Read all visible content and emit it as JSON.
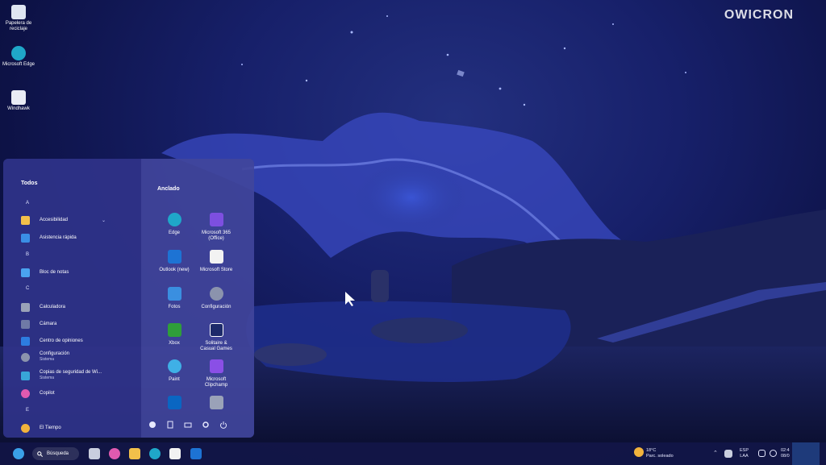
{
  "watermark": "OWICRON",
  "desktop": {
    "icons": [
      {
        "name": "recycle-bin-icon",
        "label_line1": "Papelera de",
        "label_line2": "reciclaje"
      },
      {
        "name": "edge-desktop-icon",
        "label_line1": "Microsoft Edge",
        "label_line2": ""
      },
      {
        "name": "windhawk-icon",
        "label_line1": "Windhawk",
        "label_line2": ""
      }
    ]
  },
  "start_menu": {
    "all_header": "Todos",
    "pinned_header": "Anclado",
    "letters": [
      "A",
      "B",
      "C",
      "E"
    ],
    "apps": [
      {
        "label": "Accesibilidad",
        "sub": "",
        "icon": "folder-icon",
        "color": "#f2c04a"
      },
      {
        "label": "Asistencia rápida",
        "sub": "",
        "icon": "quick-assist-icon",
        "color": "#3a8ee6"
      },
      {
        "label": "Bloc de notas",
        "sub": "",
        "icon": "notepad-icon",
        "color": "#4aa3f0"
      },
      {
        "label": "Calculadora",
        "sub": "",
        "icon": "calculator-icon",
        "color": "#9aa2b8"
      },
      {
        "label": "Cámara",
        "sub": "",
        "icon": "camera-icon",
        "color": "#6f7aa6"
      },
      {
        "label": "Centro de opiniones",
        "sub": "",
        "icon": "feedback-icon",
        "color": "#2d7de0"
      },
      {
        "label": "Configuración",
        "sub": "Sistema",
        "icon": "settings-icon",
        "color": "#8b93ad"
      },
      {
        "label": "Copias de seguridad de Wi...",
        "sub": "Sistema",
        "icon": "backup-icon",
        "color": "#38a6d8"
      },
      {
        "label": "Copilot",
        "sub": "",
        "icon": "copilot-icon",
        "color": "#e05ab0"
      },
      {
        "label": "El Tiempo",
        "sub": "",
        "icon": "weather-icon",
        "color": "#f2b33c"
      }
    ],
    "pinned": [
      {
        "label": "Edge",
        "label2": "",
        "icon": "edge-icon",
        "color": "#1fa7c9"
      },
      {
        "label": "Microsoft 365",
        "label2": "(Office)",
        "icon": "office-icon",
        "color": "#7d4fe0"
      },
      {
        "label": "Outlook (new)",
        "label2": "",
        "icon": "outlook-icon",
        "color": "#1d73d4"
      },
      {
        "label": "Microsoft Store",
        "label2": "",
        "icon": "store-icon",
        "color": "#f2f2f2"
      },
      {
        "label": "Fotos",
        "label2": "",
        "icon": "photos-icon",
        "color": "#3a8fe0"
      },
      {
        "label": "Configuración",
        "label2": "",
        "icon": "settings-pinned-icon",
        "color": "#8b93ad"
      },
      {
        "label": "Xbox",
        "label2": "",
        "icon": "xbox-icon",
        "color": "#2f9e3a"
      },
      {
        "label": "Solitaire &",
        "label2": "Casual Games",
        "icon": "solitaire-icon",
        "color": "#1d2a6a"
      },
      {
        "label": "Paint",
        "label2": "",
        "icon": "paint-icon",
        "color": "#3fb0e6"
      },
      {
        "label": "Microsoft",
        "label2": "Clipchamp",
        "icon": "clipchamp-icon",
        "color": "#8a4fe6"
      },
      {
        "label": "",
        "label2": "",
        "icon": "linkedin-icon",
        "color": "#0a66c2"
      },
      {
        "label": "",
        "label2": "",
        "icon": "calculator-pinned-icon",
        "color": "#9aa2b8"
      }
    ]
  },
  "taskbar": {
    "search_label": "Búsqueda",
    "weather_temp": "18°C",
    "weather_desc": "Parc. soleado",
    "lang1": "ESP",
    "lang2": "LAA",
    "time": "02:4",
    "date": "08/0"
  }
}
